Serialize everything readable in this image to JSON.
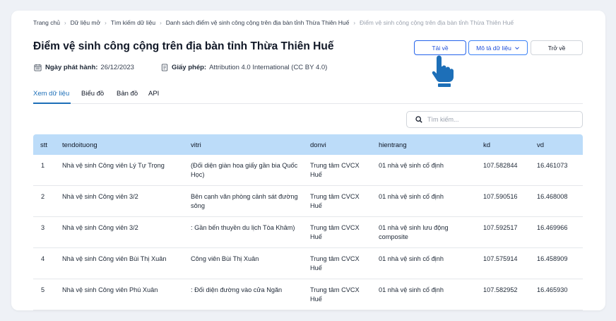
{
  "breadcrumb": [
    "Trang chủ",
    "Dữ liệu mở",
    "Tìm kiếm dữ liệu",
    "Danh sách điểm vệ sinh công cộng trên địa bàn tỉnh Thừa Thiên Huế",
    "Điểm vệ sinh công cộng trên địa bàn tỉnh Thừa Thiên Huế"
  ],
  "page": {
    "title": "Điểm vệ sinh công cộng trên địa bàn tỉnh Thừa Thiên Huế",
    "publish_label": "Ngày phát hành:",
    "publish_date": "26/12/2023",
    "license_label": "Giấy phép:",
    "license_value": "Attribution 4.0 International (CC BY 4.0)"
  },
  "actions": {
    "download": "Tải về",
    "describe": "Mô tả dữ liệu",
    "back": "Trở về"
  },
  "tabs": [
    "Xem dữ liệu",
    "Biểu đồ",
    "Bản đồ",
    "API"
  ],
  "search": {
    "placeholder": "Tìm kiếm..."
  },
  "table": {
    "headers": [
      "stt",
      "tendoituong",
      "vitri",
      "donvi",
      "hientrang",
      "kd",
      "vd"
    ],
    "rows": [
      [
        "1",
        "Nhà vệ sinh Công viên Lý Tự Trọng",
        "(Đối diện giàn hoa giấy gần bia Quốc Học)",
        "Trung tâm CVCX Huế",
        "01 nhà vệ sinh cố định",
        "107.582844",
        "16.461073"
      ],
      [
        "2",
        "Nhà vệ sinh Công viên 3/2",
        "Bên cạnh văn phòng cảnh sát đường sông",
        "Trung tâm CVCX Huế",
        "01 nhà vệ sinh cố định",
        "107.590516",
        "16.468008"
      ],
      [
        "3",
        "Nhà vệ sinh Công viên 3/2",
        ": Gần bến thuyền du lịch Tòa Khâm)",
        "Trung tâm CVCX Huế",
        "01 nhà vệ sinh lưu động composite",
        "107.592517",
        "16.469966"
      ],
      [
        "4",
        "Nhà vệ sinh Công viên Bùi Thị Xuân",
        "Công viên Bùi Thị Xuân",
        "Trung tâm CVCX Huế",
        "01 nhà vệ sinh cố định",
        "107.575914",
        "16.458909"
      ],
      [
        "5",
        "Nhà vệ sinh Công viên Phú Xuân",
        ": Đối diện đường vào cửa Ngăn",
        "Trung tâm CVCX Huế",
        "01 nhà vệ sinh cố định",
        "107.582952",
        "16.465930"
      ]
    ]
  },
  "colors": {
    "accent": "#1d6fb8",
    "header_bg": "#bcdcf9",
    "primary_button": "#2563eb"
  },
  "icons": {
    "publish": "calendar-icon",
    "license": "document-icon",
    "search": "search-icon",
    "dropdown": "chevron-down-icon",
    "pointer": "hand-pointer-icon"
  }
}
